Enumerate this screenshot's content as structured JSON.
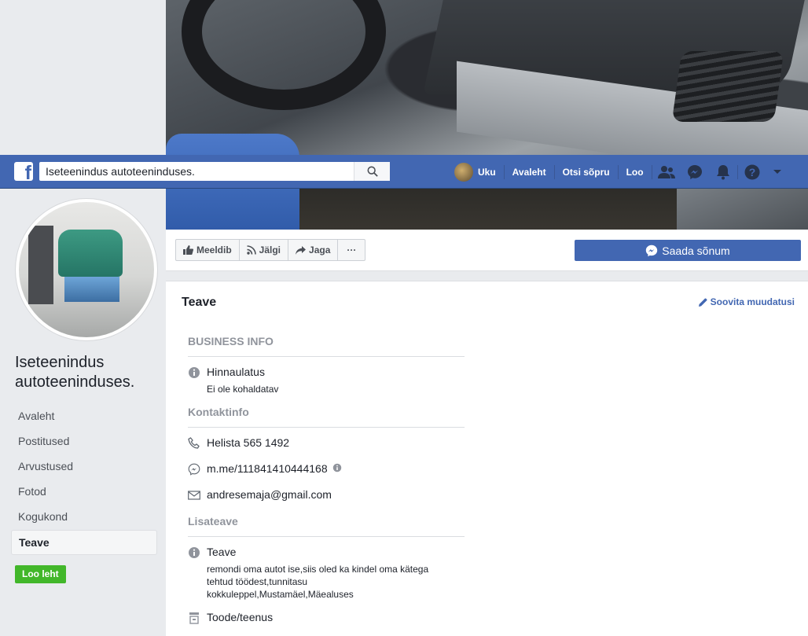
{
  "topbar": {
    "search_value": "Iseteenindus autoteeninduses.",
    "user_name": "Uku",
    "links": [
      "Avaleht",
      "Otsi sõpru",
      "Loo"
    ]
  },
  "page": {
    "name": "Iseteenindus autoteeninduses."
  },
  "sidebar": {
    "items": [
      {
        "label": "Avaleht",
        "active": false
      },
      {
        "label": "Postitused",
        "active": false
      },
      {
        "label": "Arvustused",
        "active": false
      },
      {
        "label": "Fotod",
        "active": false
      },
      {
        "label": "Kogukond",
        "active": false
      },
      {
        "label": "Teave",
        "active": true
      }
    ],
    "create_page_label": "Loo leht"
  },
  "actions": {
    "like": "Meeldib",
    "follow": "Jälgi",
    "share": "Jaga",
    "more": "···",
    "send_message": "Saada sõnum"
  },
  "about": {
    "title": "Teave",
    "suggest_edits": "Soovita muudatusi",
    "business_info_heading": "BUSINESS INFO",
    "price_label": "Hinnaulatus",
    "price_value": "Ei ole kohaldatav",
    "contact_heading": "Kontaktinfo",
    "phone": "Helista 565 1492",
    "messenger": "m.me/111841410444168",
    "email": "andresemaja@gmail.com",
    "more_info_heading": "Lisateave",
    "about_label": "Teave",
    "about_text": "remondi oma autot ise,siis oled ka kindel oma kätega tehtud töödest,tunnitasu kokkuleppel,Mustamäel,Mäealuses",
    "category": "Toode/teenus"
  }
}
